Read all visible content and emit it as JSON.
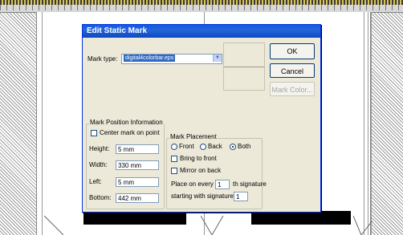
{
  "dialog": {
    "title": "Edit Static Mark",
    "mark_type_label": "Mark type:",
    "mark_type_value": "digital4colorbar.eps",
    "buttons": {
      "ok": "OK",
      "cancel": "Cancel",
      "mark_color": "Mark Color..."
    },
    "position_group": {
      "title": "Mark Position Information",
      "center_label": "Center mark on point",
      "center_checked": false,
      "height_label": "Height:",
      "height_value": "5 mm",
      "width_label": "Width:",
      "width_value": "330 mm",
      "left_label": "Left:",
      "left_value": "5 mm",
      "bottom_label": "Bottom:",
      "bottom_value": "442 mm"
    },
    "placement_group": {
      "title": "Mark Placement",
      "radio_front": "Front",
      "radio_back": "Back",
      "radio_both": "Both",
      "selected": "Both",
      "bring_to_front": "Bring to front",
      "mirror_on_back": "Mirror on back",
      "place_on_every_label": "Place on every",
      "place_on_every_value": "1",
      "th_signature": "th signature",
      "starting_with_label": "starting with signature",
      "starting_with_value": "1"
    }
  },
  "colors": {
    "title_bar": "#0a5ce6",
    "dialog_bg": "#ece9d8",
    "selection": "#316ac5"
  }
}
